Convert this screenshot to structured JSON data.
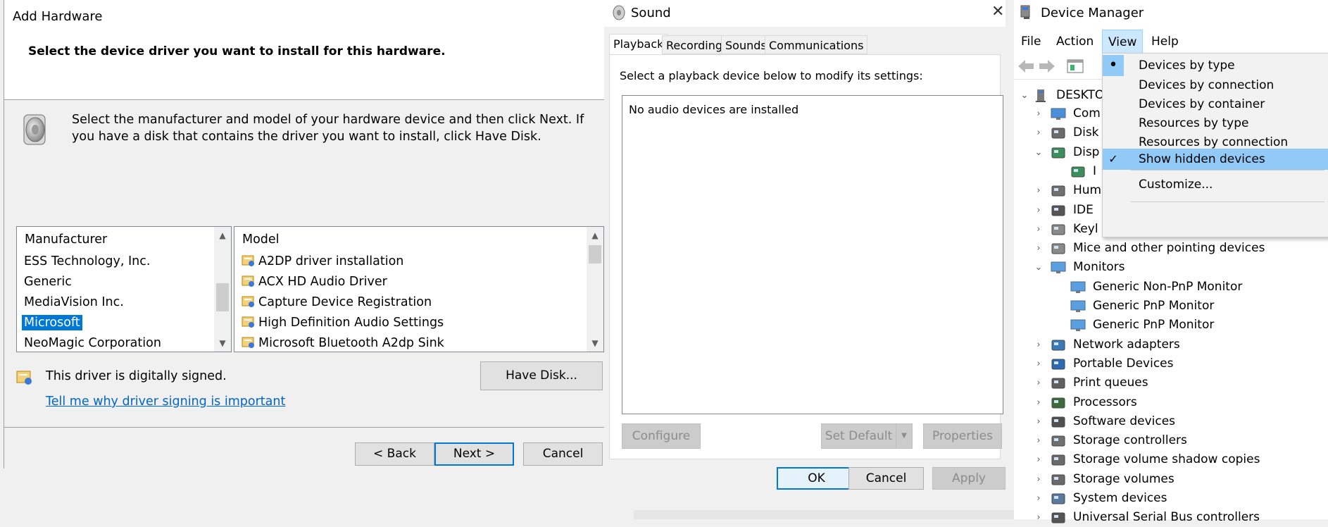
{
  "add_hardware": {
    "title": "Add Hardware",
    "heading": "Select the device driver you want to install for this hardware.",
    "instructions": "Select the manufacturer and model of your hardware device and then click Next. If you have a disk that contains the driver you want to install, click Have Disk.",
    "manufacturer_header": "Manufacturer",
    "manufacturers": [
      "ESS Technology, Inc.",
      "Generic",
      "MediaVision Inc.",
      "Microsoft",
      "NeoMagic Corporation"
    ],
    "selected_manufacturer": "Microsoft",
    "model_header": "Model",
    "models": [
      "A2DP driver installation",
      "ACX HD Audio Driver",
      "Capture Device Registration",
      "High Definition Audio Settings",
      "Microsoft Bluetooth A2dp Sink"
    ],
    "signed_text": "This driver is digitally signed.",
    "signing_link": "Tell me why driver signing is important",
    "have_disk": "Have Disk...",
    "back": "< Back",
    "next": "Next >",
    "cancel": "Cancel"
  },
  "sound": {
    "title": "Sound",
    "tabs": [
      "Playback",
      "Recording",
      "Sounds",
      "Communications"
    ],
    "active_tab": "Playback",
    "prompt": "Select a playback device below to modify its settings:",
    "empty_text": "No audio devices are installed",
    "configure": "Configure",
    "set_default": "Set Default",
    "properties": "Properties",
    "ok": "OK",
    "cancel": "Cancel",
    "apply": "Apply"
  },
  "device_manager": {
    "title": "Device Manager",
    "menus": [
      "File",
      "Action",
      "View",
      "Help"
    ],
    "open_menu": "View",
    "root": "DESKTO",
    "tree": [
      {
        "label": "Com",
        "expanded": false,
        "icon": "computer-icon"
      },
      {
        "label": "Disk",
        "expanded": false,
        "icon": "disk-drive-icon"
      },
      {
        "label": "Disp",
        "expanded": true,
        "icon": "display-adapter-icon"
      },
      {
        "label": "I",
        "child": true,
        "icon": "display-adapter-icon"
      },
      {
        "label": "Hum",
        "expanded": false,
        "icon": "hid-icon"
      },
      {
        "label": "IDE",
        "expanded": false,
        "icon": "ide-icon"
      },
      {
        "label": "Keyl",
        "expanded": false,
        "icon": "keyboard-icon"
      },
      {
        "label": "Mice and other pointing devices",
        "expanded": false,
        "icon": "mouse-icon"
      },
      {
        "label": "Monitors",
        "expanded": true,
        "icon": "monitor-icon"
      },
      {
        "label": "Generic Non-PnP Monitor",
        "child": true,
        "icon": "monitor-icon"
      },
      {
        "label": "Generic PnP Monitor",
        "child": true,
        "icon": "monitor-icon"
      },
      {
        "label": "Generic PnP Monitor",
        "child": true,
        "icon": "monitor-icon"
      },
      {
        "label": "Network adapters",
        "expanded": false,
        "icon": "network-adapter-icon"
      },
      {
        "label": "Portable Devices",
        "expanded": false,
        "icon": "portable-device-icon"
      },
      {
        "label": "Print queues",
        "expanded": false,
        "icon": "printer-icon"
      },
      {
        "label": "Processors",
        "expanded": false,
        "icon": "processor-icon"
      },
      {
        "label": "Software devices",
        "expanded": false,
        "icon": "software-device-icon"
      },
      {
        "label": "Storage controllers",
        "expanded": false,
        "icon": "storage-controller-icon"
      },
      {
        "label": "Storage volume shadow copies",
        "expanded": false,
        "icon": "disk-drive-icon"
      },
      {
        "label": "Storage volumes",
        "expanded": false,
        "icon": "disk-drive-icon"
      },
      {
        "label": "System devices",
        "expanded": false,
        "icon": "system-device-icon"
      },
      {
        "label": "Universal Serial Bus controllers",
        "expanded": false,
        "icon": "usb-icon"
      }
    ],
    "view_menu": [
      {
        "label": "Devices by type",
        "mark": "bullet"
      },
      {
        "label": "Devices by connection",
        "mark": ""
      },
      {
        "label": "Devices by container",
        "mark": ""
      },
      {
        "label": "Resources by type",
        "mark": ""
      },
      {
        "label": "Resources by connection",
        "mark": ""
      },
      {
        "label": "Show hidden devices",
        "mark": "check",
        "highlighted": true
      },
      {
        "label": "Customize...",
        "mark": ""
      }
    ]
  },
  "colors": {
    "accent": "#0078d7",
    "link": "#0066cc",
    "menu_highlight": "#91c9f7"
  }
}
